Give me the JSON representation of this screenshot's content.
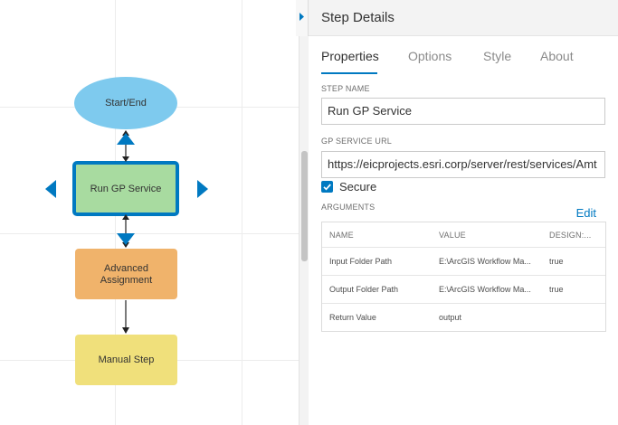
{
  "diagram": {
    "nodes": [
      {
        "id": "start-end",
        "label": "Start/End",
        "shape": "ellipse",
        "fill": "#7ecaee"
      },
      {
        "id": "run-gp",
        "label": "Run GP Service",
        "shape": "rect",
        "fill": "#a8dba0",
        "selected": true
      },
      {
        "id": "advanced",
        "label": "Advanced Assignment",
        "shape": "rect",
        "fill": "#f0b36b"
      },
      {
        "id": "manual",
        "label": "Manual Step",
        "shape": "rect",
        "fill": "#f0e07b"
      }
    ],
    "selection_color": "#0079c1"
  },
  "panel": {
    "title": "Step Details",
    "tabs": [
      {
        "label": "Properties",
        "active": true
      },
      {
        "label": "Options",
        "active": false
      },
      {
        "label": "Style",
        "active": false
      },
      {
        "label": "About",
        "active": false
      }
    ],
    "step_name": {
      "label": "STEP NAME",
      "value": "Run GP Service"
    },
    "gp_url": {
      "label": "GP SERVICE URL",
      "value": "https://eicprojects.esri.corp/server/rest/services/Amt"
    },
    "secure": {
      "label": "Secure",
      "checked": true
    },
    "arguments": {
      "label": "ARGUMENTS",
      "edit_label": "Edit",
      "columns": [
        "NAME",
        "VALUE",
        "DESIGN:..."
      ],
      "rows": [
        [
          "Input Folder Path",
          "E:\\ArcGIS Workflow Ma...",
          "true"
        ],
        [
          "Output Folder Path",
          "E:\\ArcGIS Workflow Ma...",
          "true"
        ],
        [
          "Return Value",
          "output",
          ""
        ]
      ]
    }
  },
  "colors": {
    "accent": "#0079c1"
  }
}
